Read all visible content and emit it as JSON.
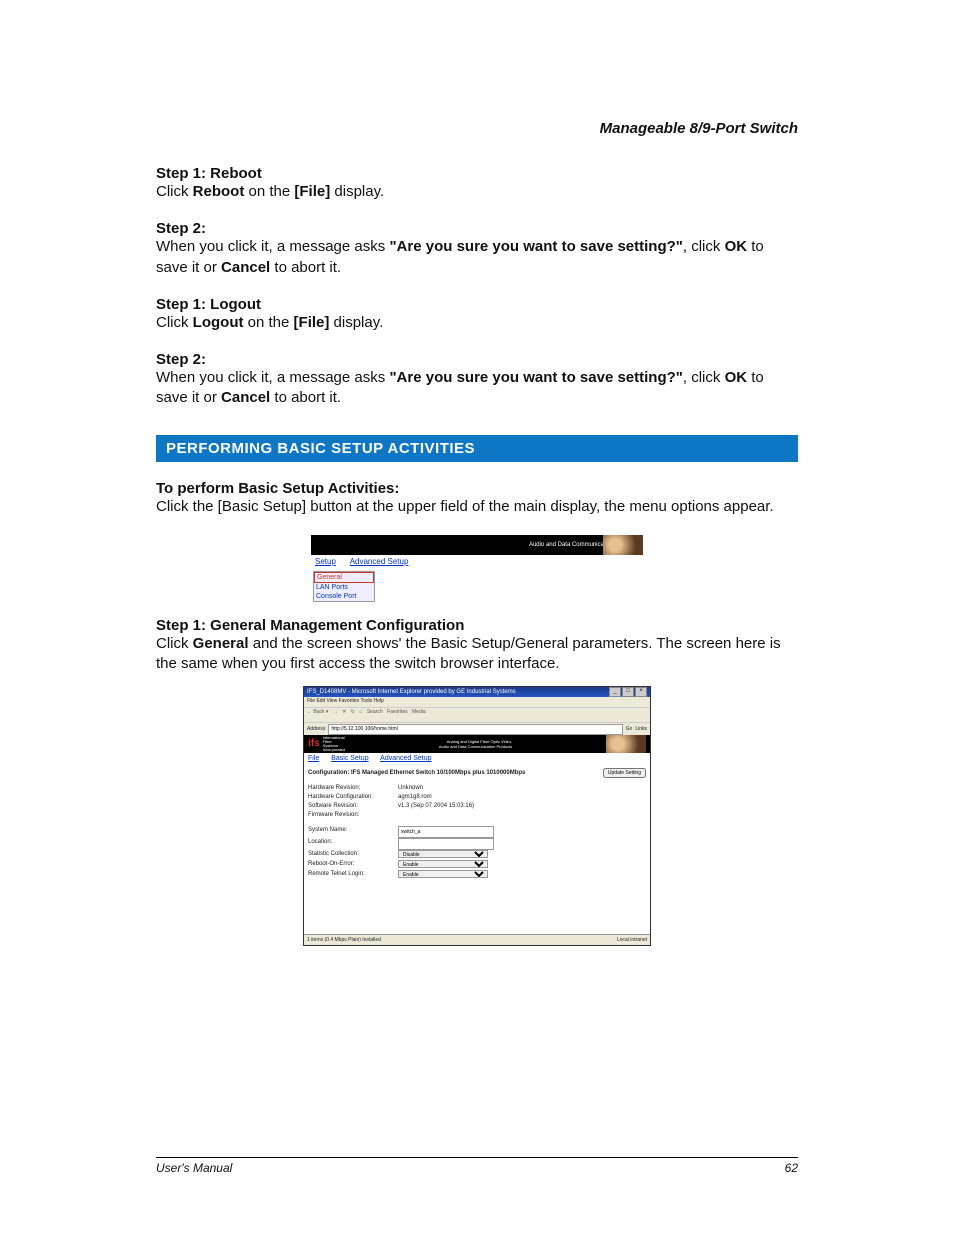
{
  "doc_title": "Manageable 8/9-Port Switch",
  "steps": {
    "reboot": {
      "heading": "Step 1: Reboot",
      "pre": "Click ",
      "bold1": "Reboot",
      "mid": " on the ",
      "bold2": "[File]",
      "post": " display."
    },
    "reboot2": {
      "heading": "Step 2:",
      "pre": "When you click it, a message asks ",
      "bold1": "\"Are you sure you want to save setting?\"",
      "mid1": ", click ",
      "bold2": "OK",
      "mid2": " to save it or ",
      "bold3": "Cancel",
      "post": " to abort it."
    },
    "logout": {
      "heading": "Step 1: Logout",
      "pre": "Click ",
      "bold1": "Logout",
      "mid": " on the ",
      "bold2": "[File]",
      "post": " display."
    },
    "logout2": {
      "heading": "Step 2:",
      "pre": "When you click it, a message asks ",
      "bold1": "\"Are you sure you want to save setting?\"",
      "mid1": ", click ",
      "bold2": "OK",
      "mid2": " to save it or ",
      "bold3": "Cancel",
      "post": " to abort it."
    }
  },
  "section_bar": "PERFORMING BASIC SETUP ACTIVITIES",
  "basic_setup": {
    "heading": "To perform Basic Setup Activities:",
    "text": "Click the [Basic Setup] button at the upper field of the main display, the menu options appear."
  },
  "gmc": {
    "heading": "Step 1: General Management Configuration",
    "pre": "Click ",
    "bold": "General",
    "post": " and the screen shows' the Basic Setup/General parameters. The screen here is the same when you first access the switch browser interface."
  },
  "shot1": {
    "banner_right": "Audio and Data Communication Products",
    "menu_setup": "Setup",
    "menu_adv": "Advanced Setup",
    "side_general": "General",
    "side_lan": "LAN Ports",
    "side_console": "Console Port"
  },
  "shot2": {
    "title": "IFS_D1408MV - Microsoft Internet Explorer provided by GE Industrial Systems",
    "menubar": "File   Edit   View   Favorites   Tools   Help",
    "toolbar": {
      "back": "Back",
      "search": "Search",
      "fav": "Favorites",
      "media": "Media"
    },
    "addr_label": "Address",
    "addr_value": "http://5.12.100.106/home.html",
    "go": "Go",
    "links": "Links",
    "banner_logo": "ifs",
    "banner_sub": "International\nFiber\nSystems\nIncorporated",
    "banner_right": "Analog and Digital Fiber Optic Video,\nAudio and Data Communication Products",
    "menu_file": "File",
    "menu_basic": "Basic Setup",
    "menu_adv": "Advanced Setup",
    "config_text": "Configuration: IFS Managed Ethernet Switch  10/100Mbps plus 1010000Mbps",
    "update_btn": "Update Setting",
    "rows": {
      "hw_rev_l": "Hardware Revision:",
      "hw_rev_v": "Unknown",
      "hw_cfg_l": "Hardware Configuration:",
      "hw_cfg_v": "agm1g8.rom",
      "sw_rev_l": "Software Revision:",
      "sw_rev_v": "v1.3 (Sep 07 2004 15:03:16)",
      "fw_rev_l": "Firmware Revision:",
      "fw_rev_v": "",
      "sys_name_l": "System Name:",
      "sys_name_v": "switch_a",
      "loc_l": "Location:",
      "loc_v": "",
      "stat_l": "Statistic Collection:",
      "stat_v": "Disable",
      "roe_l": "Reboot-On-Error:",
      "roe_v": "Enable",
      "rtl_l": "Remote Telnet Login:",
      "rtl_v": "Enable"
    },
    "status_left": "1 items (0.4 Mbps Plain) Installed",
    "status_right": "Local intranet"
  },
  "footer": {
    "left": "User's Manual",
    "right": "62"
  }
}
